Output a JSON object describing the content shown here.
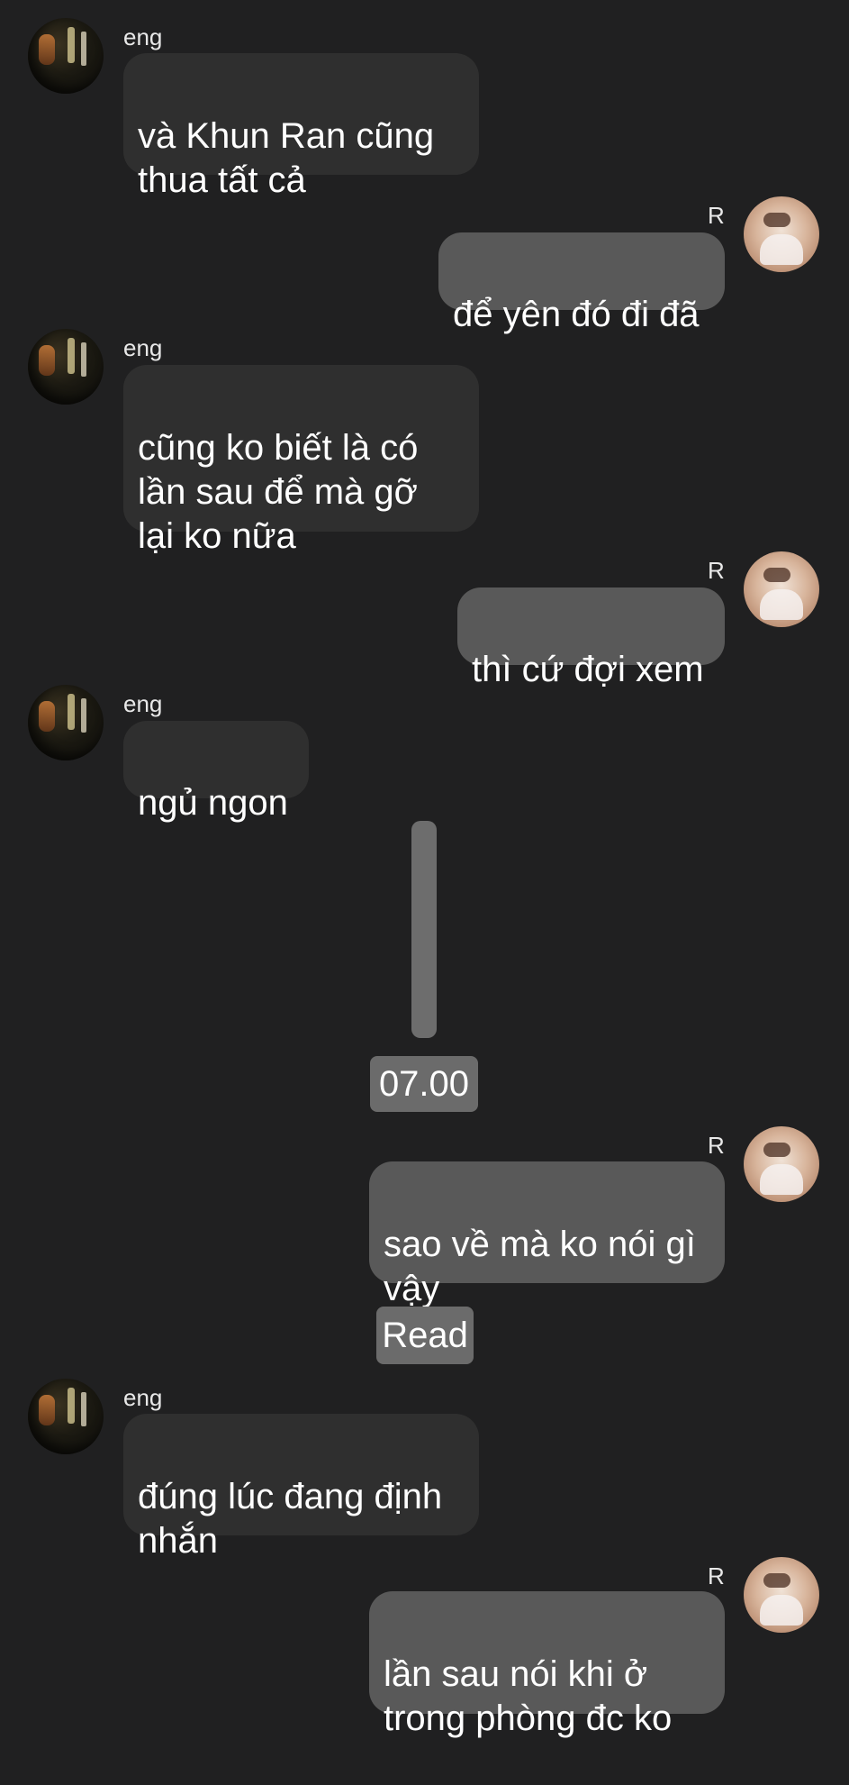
{
  "messages": [
    {
      "side": "left",
      "sender": "eng",
      "text": "và Khun Ran cũng\nthua tất cả"
    },
    {
      "side": "right",
      "sender": "R",
      "text": "để yên đó đi đã"
    },
    {
      "side": "left",
      "sender": "eng",
      "text": "cũng ko biết là có\nlần sau để mà gỡ\nlại ko nữa"
    },
    {
      "side": "right",
      "sender": "R",
      "text": "thì cứ đợi xem"
    },
    {
      "side": "left",
      "sender": "eng",
      "text": "ngủ ngon"
    },
    {
      "side": "right",
      "sender": "R",
      "text": "sao về mà ko nói gì\nvậy"
    },
    {
      "side": "left",
      "sender": "eng",
      "text": "đúng lúc đang định\nnhắn"
    },
    {
      "side": "right",
      "sender": "R",
      "text": "lần sau nói khi ở\ntrong phòng đc ko"
    }
  ],
  "time_divider": "07.00",
  "read_receipt": "Read",
  "colors": {
    "background": "#202021",
    "incoming_bubble": "#2f2f2f",
    "outgoing_bubble": "#595959",
    "pill": "#6b6b6b"
  }
}
